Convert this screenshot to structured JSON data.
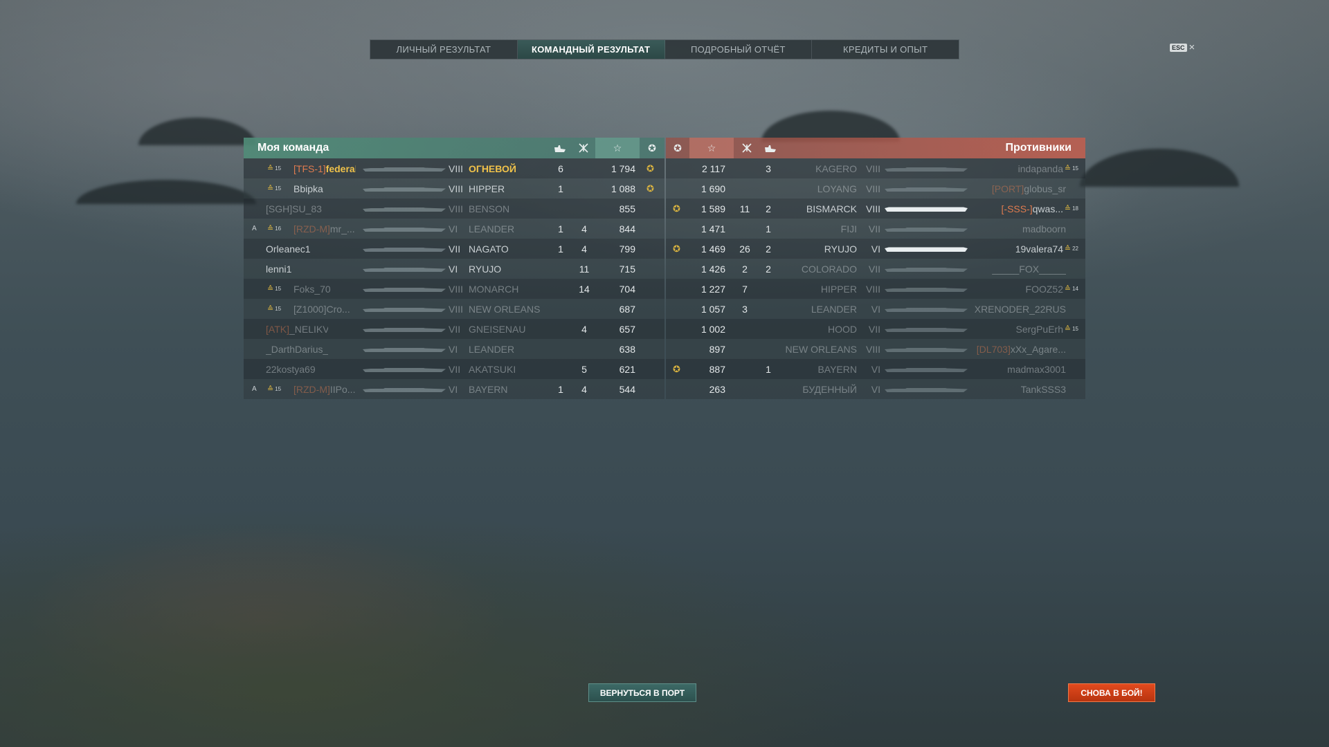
{
  "tabs": [
    {
      "label": "ЛИЧНЫЙ РЕЗУЛЬТАТ"
    },
    {
      "label": "КОМАНДНЫЙ РЕЗУЛЬТАТ"
    },
    {
      "label": "ПОДРОБНЫЙ ОТЧЁТ"
    },
    {
      "label": "КРЕДИТЫ И ОПЫТ"
    }
  ],
  "active_tab": "КОМАНДНЫЙ РЕЗУЛЬТАТ",
  "esc": {
    "key": "ESC",
    "close": "×"
  },
  "my_team": {
    "title": "Моя команда",
    "header_icons": [
      "ship-icon",
      "aircraft-icon",
      "star-icon",
      "medal-icon"
    ],
    "rows": [
      {
        "division": "",
        "rank": "15",
        "clan": "[TFS-1]",
        "name": "federal",
        "tier": "VIII",
        "ship": "ОГНЕВОЙ",
        "ships_killed": "6",
        "planes_killed": "",
        "xp": "1 794",
        "medal": "✪",
        "highlight": "gold",
        "dim": false
      },
      {
        "division": "",
        "rank": "15",
        "clan": "",
        "name": "Bbipka",
        "tier": "VIII",
        "ship": "HIPPER",
        "ships_killed": "1",
        "planes_killed": "",
        "xp": "1 088",
        "medal": "✪",
        "highlight": "",
        "dim": false
      },
      {
        "division": "",
        "rank": "",
        "clan": "",
        "name": "[SGH]SU_83",
        "tier": "VIII",
        "ship": "BENSON",
        "ships_killed": "",
        "planes_killed": "",
        "xp": "855",
        "medal": "",
        "highlight": "",
        "dim": true
      },
      {
        "division": "A",
        "rank": "16",
        "clan": "[RZD-M]",
        "name": "mr_...",
        "tier": "VI",
        "ship": "LEANDER",
        "ships_killed": "1",
        "planes_killed": "4",
        "xp": "844",
        "medal": "",
        "highlight": "",
        "dim": true
      },
      {
        "division": "",
        "rank": "",
        "clan": "",
        "name": "Orleanec1",
        "tier": "VII",
        "ship": "NAGATO",
        "ships_killed": "1",
        "planes_killed": "4",
        "xp": "799",
        "medal": "",
        "highlight": "",
        "dim": false
      },
      {
        "division": "",
        "rank": "",
        "clan": "",
        "name": "lenni1",
        "tier": "VI",
        "ship": "RYUJO",
        "ships_killed": "",
        "planes_killed": "11",
        "xp": "715",
        "medal": "",
        "highlight": "",
        "dim": false
      },
      {
        "division": "",
        "rank": "15",
        "clan": "",
        "name": "Foks_70",
        "tier": "VIII",
        "ship": "MONARCH",
        "ships_killed": "",
        "planes_killed": "14",
        "xp": "704",
        "medal": "",
        "highlight": "",
        "dim": true
      },
      {
        "division": "",
        "rank": "15",
        "clan": "",
        "name": "[Z1000]Cro...",
        "tier": "VIII",
        "ship": "NEW ORLEANS",
        "ships_killed": "",
        "planes_killed": "",
        "xp": "687",
        "medal": "",
        "highlight": "",
        "dim": true
      },
      {
        "division": "",
        "rank": "",
        "clan": "[ATK]",
        "name": "_NELIKVID_",
        "tier": "VII",
        "ship": "GNEISENAU",
        "ships_killed": "",
        "planes_killed": "4",
        "xp": "657",
        "medal": "",
        "highlight": "",
        "dim": true
      },
      {
        "division": "",
        "rank": "",
        "clan": "",
        "name": "_DarthDarius_",
        "tier": "VI",
        "ship": "LEANDER",
        "ships_killed": "",
        "planes_killed": "",
        "xp": "638",
        "medal": "",
        "highlight": "",
        "dim": true
      },
      {
        "division": "",
        "rank": "",
        "clan": "",
        "name": "22kostya69",
        "tier": "VII",
        "ship": "AKATSUKI",
        "ships_killed": "",
        "planes_killed": "5",
        "xp": "621",
        "medal": "",
        "highlight": "",
        "dim": true
      },
      {
        "division": "A",
        "rank": "15",
        "clan": "[RZD-M]",
        "name": "IIPo...",
        "tier": "VI",
        "ship": "BAYERN",
        "ships_killed": "1",
        "planes_killed": "4",
        "xp": "544",
        "medal": "",
        "highlight": "",
        "dim": true
      }
    ]
  },
  "enemy_team": {
    "title": "Противники",
    "header_icons": [
      "medal-icon",
      "star-icon",
      "aircraft-icon",
      "ship-icon"
    ],
    "rows": [
      {
        "medal": "",
        "xp": "2 117",
        "planes_killed": "",
        "ships_killed": "3",
        "ship": "KAGERO",
        "tier": "VIII",
        "clan": "",
        "name": "indapanda",
        "rank": "15",
        "dim": true
      },
      {
        "medal": "",
        "xp": "1 690",
        "planes_killed": "",
        "ships_killed": "",
        "ship": "LOYANG",
        "tier": "VIII",
        "clan": "[PORT]",
        "name": "globus_sr",
        "rank": "",
        "dim": true
      },
      {
        "medal": "✪",
        "xp": "1 589",
        "planes_killed": "11",
        "ships_killed": "2",
        "ship": "BISMARCK",
        "tier": "VIII",
        "clan": "[-SSS-]",
        "name": "qwas...",
        "rank": "18",
        "dim": false
      },
      {
        "medal": "",
        "xp": "1 471",
        "planes_killed": "",
        "ships_killed": "1",
        "ship": "FIJI",
        "tier": "VII",
        "clan": "",
        "name": "madboorn",
        "rank": "",
        "dim": true
      },
      {
        "medal": "✪",
        "xp": "1 469",
        "planes_killed": "26",
        "ships_killed": "2",
        "ship": "RYUJO",
        "tier": "VI",
        "clan": "",
        "name": "19valera74",
        "rank": "22",
        "dim": false
      },
      {
        "medal": "",
        "xp": "1 426",
        "planes_killed": "2",
        "ships_killed": "2",
        "ship": "COLORADO",
        "tier": "VII",
        "clan": "",
        "name": "_____FOX_____",
        "rank": "",
        "dim": true
      },
      {
        "medal": "",
        "xp": "1 227",
        "planes_killed": "7",
        "ships_killed": "",
        "ship": "HIPPER",
        "tier": "VIII",
        "clan": "",
        "name": "FOOZ52",
        "rank": "14",
        "dim": true
      },
      {
        "medal": "",
        "xp": "1 057",
        "planes_killed": "3",
        "ships_killed": "",
        "ship": "LEANDER",
        "tier": "VI",
        "clan": "",
        "name": "XRENODER_22RUS",
        "rank": "",
        "dim": true
      },
      {
        "medal": "",
        "xp": "1 002",
        "planes_killed": "",
        "ships_killed": "",
        "ship": "HOOD",
        "tier": "VII",
        "clan": "",
        "name": "SergPuErh",
        "rank": "15",
        "dim": true
      },
      {
        "medal": "",
        "xp": "897",
        "planes_killed": "",
        "ships_killed": "",
        "ship": "NEW ORLEANS",
        "tier": "VIII",
        "clan": "[DL703]",
        "name": "xXx_Agare...",
        "rank": "",
        "dim": true
      },
      {
        "medal": "✪",
        "xp": "887",
        "planes_killed": "",
        "ships_killed": "1",
        "ship": "BAYERN",
        "tier": "VI",
        "clan": "",
        "name": "madmax3001",
        "rank": "",
        "dim": true
      },
      {
        "medal": "",
        "xp": "263",
        "planes_killed": "",
        "ships_killed": "",
        "ship": "БУДЕННЫЙ",
        "tier": "VI",
        "clan": "",
        "name": "TankSSS3",
        "rank": "",
        "dim": true
      }
    ]
  },
  "buttons": {
    "port": "ВЕРНУТЬСЯ В ПОРТ",
    "battle": "СНОВА В БОЙ!"
  },
  "colors": {
    "my_team": "#4f8c78",
    "enemy_team": "#be5f50",
    "clan": "#e07b4f",
    "gold": "#f0c24a",
    "battle_button": "#d3401a"
  }
}
